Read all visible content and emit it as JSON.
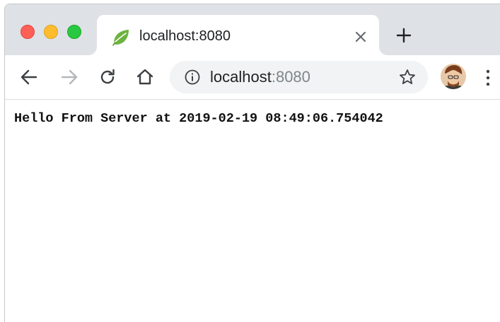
{
  "tab": {
    "title": "localhost:8080",
    "favicon": "spring-leaf-icon"
  },
  "omnibox": {
    "host": "localhost",
    "port": ":8080"
  },
  "page": {
    "text": "Hello From Server at 2019-02-19 08:49:06.754042"
  },
  "colors": {
    "traffic_close": "#fe5f57",
    "traffic_minimize": "#febc2e",
    "traffic_maximize": "#28c840",
    "tabstrip_bg": "#dee1e6",
    "omnibox_bg": "#f1f3f4",
    "port_text": "#80868b"
  },
  "icons": {
    "back": "arrow-left-icon",
    "forward": "arrow-right-icon",
    "reload": "reload-icon",
    "home": "home-icon",
    "site_info": "info-icon",
    "bookmark": "star-icon",
    "menu": "vertical-dots-icon",
    "new_tab": "plus-icon",
    "close_tab": "close-icon"
  }
}
